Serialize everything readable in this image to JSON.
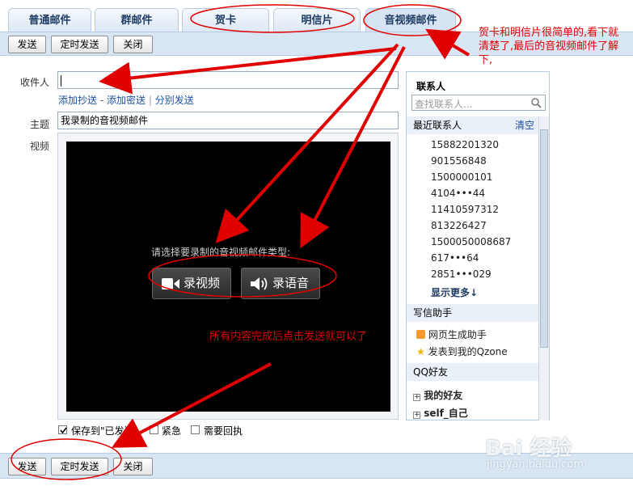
{
  "tabs": [
    {
      "label": "普通邮件"
    },
    {
      "label": "群邮件"
    },
    {
      "label": "贺卡"
    },
    {
      "label": "明信片"
    },
    {
      "label": "音视频邮件"
    }
  ],
  "toolbar": {
    "send": "发送",
    "scheduled_send": "定时发送",
    "close": "关闭"
  },
  "form": {
    "recipient_label": "收件人",
    "recipient_value": "",
    "add_cc": "添加抄送",
    "add_bcc": "添加密送",
    "separate_send": "分别发送",
    "separator_dash": "-",
    "separator_bar": "|",
    "subject_label": "主题",
    "subject_value": "我录制的音视频邮件",
    "video_label": "视频"
  },
  "video": {
    "prompt": "请选择要录制的音视频邮件类型:",
    "record_video": "录视频",
    "record_voice": "录语音"
  },
  "options": {
    "save_sent": "保存到\"已发送\"",
    "save_sent_checked": true,
    "urgent": "紧急",
    "receipt": "需要回执"
  },
  "contacts": {
    "title": "联系人",
    "search_placeholder": "查找联系人...",
    "recent_label": "最近联系人",
    "clear": "清空",
    "recent": [
      "15882201320",
      "901556848",
      "1500000101",
      "4104•••44",
      "11410597312",
      "813226427",
      "1500050008687",
      "617•••64",
      "2851•••029"
    ],
    "show_more": "显示更多↓",
    "assistant_label": "写信助手",
    "assistant_items": [
      "网页生成助手",
      "发表到我的Qzone"
    ],
    "qq_friends_label": "QQ好友",
    "groups": [
      "我的好友",
      "self_自己"
    ]
  },
  "annotations": {
    "note1": "贺卡和明信片很简单的,看下就清楚了,最后的音视频邮件了解下,",
    "note2": "所有内容完成后点击发送就可以了"
  },
  "watermark": {
    "brand": "Bai 经验",
    "url": "jingyan.baidu.com"
  }
}
